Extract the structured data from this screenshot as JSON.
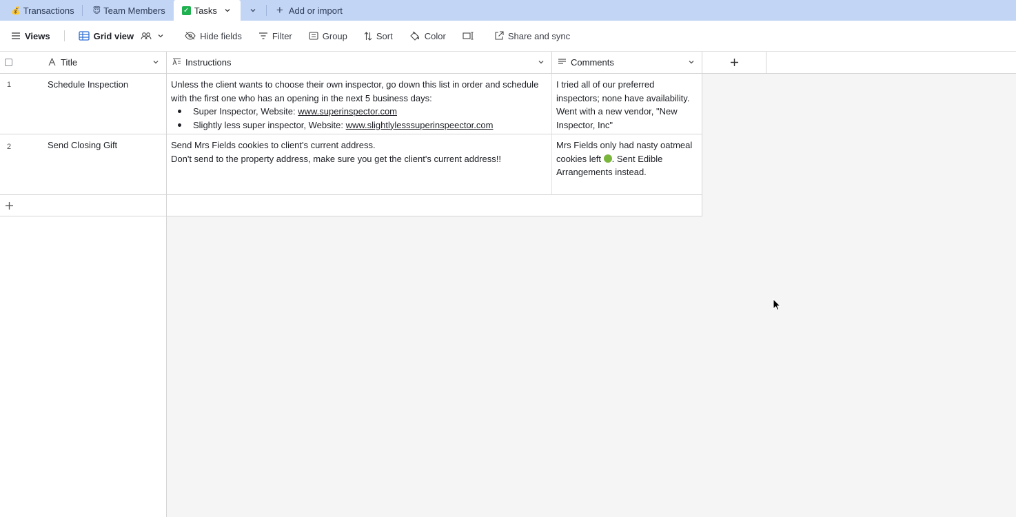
{
  "tabs": [
    {
      "emoji": "💰",
      "label": "Transactions"
    },
    {
      "emoji": "😇",
      "label": "Team Members"
    },
    {
      "emoji": "✅",
      "label": "Tasks",
      "active": true
    }
  ],
  "add_import_label": "Add or import",
  "toolbar": {
    "views": "Views",
    "grid_view": "Grid view",
    "hide_fields": "Hide fields",
    "filter": "Filter",
    "group": "Group",
    "sort": "Sort",
    "color": "Color",
    "share": "Share and sync"
  },
  "columns": {
    "title": "Title",
    "instructions": "Instructions",
    "comments": "Comments"
  },
  "rows": [
    {
      "num": "1",
      "title": "Schedule Inspection",
      "instructions_text": "Unless the client wants to choose their own inspector, go down this list in order and schedule with the first one who has an opening in the next 5 business days:",
      "bullets": [
        {
          "prefix": "Super Inspector, Website: ",
          "link": "www.superinspector.com"
        },
        {
          "prefix": "Slightly less super inspector, Website: ",
          "link": "www.slightlylesssuperinspeector.com"
        }
      ],
      "comments": "I tried all of our preferred inspectors; none have availability. Went with a new vendor, \"New Inspector, Inc\""
    },
    {
      "num": "2",
      "title": "Send Closing Gift",
      "instructions_line1": "Send Mrs Fields cookies to client's current address.",
      "instructions_line2": "Don't send to the property address, make sure you get the client's current address!!",
      "comments_pre": "Mrs Fields only had nasty oatmeal cookies left ",
      "comments_post": ". Sent Edible Arrangements instead."
    }
  ],
  "colors": {
    "tabbar_bg": "#c3d5f5",
    "grid_bg": "#f5f5f5",
    "border": "#d5d5d5"
  }
}
